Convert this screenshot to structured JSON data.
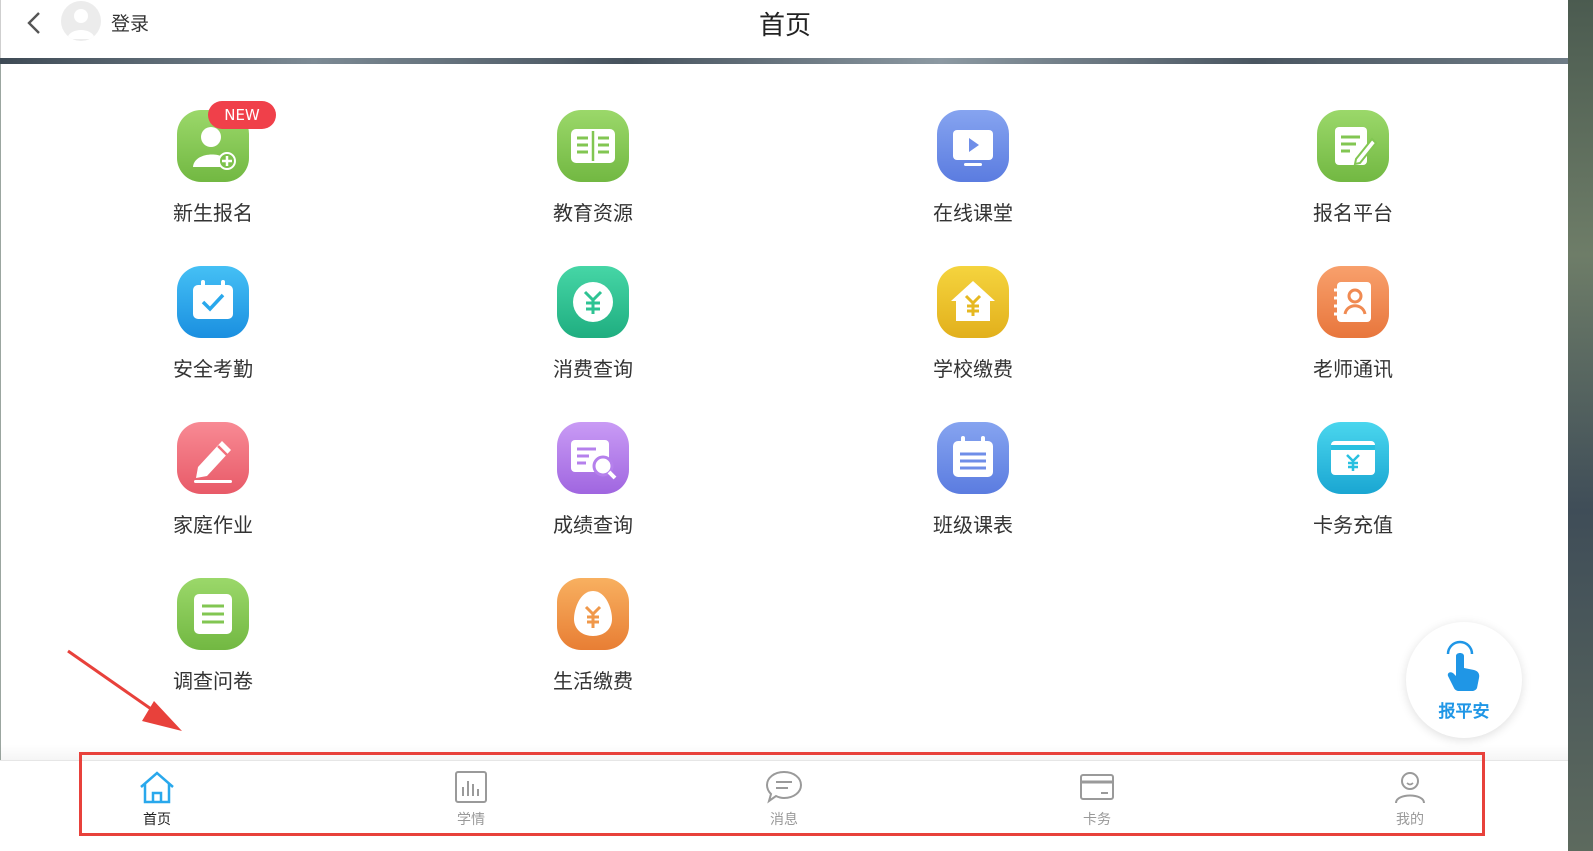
{
  "header": {
    "login_label": "登录",
    "title": "首页"
  },
  "grid": [
    {
      "id": "new-student",
      "label": "新生报名",
      "icon": "add-user-icon",
      "color": "#8ecf5a",
      "badge": "NEW"
    },
    {
      "id": "edu-resources",
      "label": "教育资源",
      "icon": "book-icon",
      "color": "#8ecf5a"
    },
    {
      "id": "online-class",
      "label": "在线课堂",
      "icon": "video-play-icon",
      "color": "#6f8ee8"
    },
    {
      "id": "signup-platform",
      "label": "报名平台",
      "icon": "edit-document-icon",
      "color": "#8ecf5a"
    },
    {
      "id": "attendance",
      "label": "安全考勤",
      "icon": "calendar-check-icon",
      "color": "#29a8ec"
    },
    {
      "id": "spending-query",
      "label": "消费查询",
      "icon": "yuan-coin-icon",
      "color": "#2ec393"
    },
    {
      "id": "school-fee",
      "label": "学校缴费",
      "icon": "yuan-house-icon",
      "color": "#ecc22a"
    },
    {
      "id": "teacher-contacts",
      "label": "老师通讯",
      "icon": "contact-book-icon",
      "color": "#f08a52"
    },
    {
      "id": "homework",
      "label": "家庭作业",
      "icon": "pencil-icon",
      "color": "#f2707c"
    },
    {
      "id": "grades",
      "label": "成绩查询",
      "icon": "search-document-icon",
      "color": "#b580ec"
    },
    {
      "id": "timetable",
      "label": "班级课表",
      "icon": "schedule-icon",
      "color": "#6f8ee8"
    },
    {
      "id": "card-topup",
      "label": "卡务充值",
      "icon": "yuan-card-icon",
      "color": "#29c0e0"
    },
    {
      "id": "survey",
      "label": "调查问卷",
      "icon": "list-icon",
      "color": "#8ecf5a"
    },
    {
      "id": "living-fee",
      "label": "生活缴费",
      "icon": "yuan-egg-icon",
      "color": "#f0984a"
    }
  ],
  "fab": {
    "label": "报平安",
    "icon": "tap-hand-icon"
  },
  "nav": [
    {
      "id": "home",
      "label": "首页",
      "icon": "home-icon",
      "active": true
    },
    {
      "id": "study",
      "label": "学情",
      "icon": "bar-chart-icon",
      "active": false
    },
    {
      "id": "messages",
      "label": "消息",
      "icon": "chat-bubble-icon",
      "active": false
    },
    {
      "id": "card",
      "label": "卡务",
      "icon": "card-icon",
      "active": false
    },
    {
      "id": "mine",
      "label": "我的",
      "icon": "user-icon",
      "active": false
    }
  ],
  "colors": {
    "accent": "#1f96e6",
    "highlight": "#e8413b"
  }
}
